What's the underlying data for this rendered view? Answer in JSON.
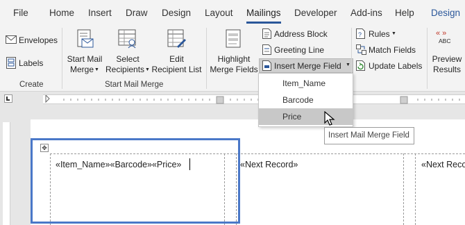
{
  "tabs": [
    {
      "label": "File"
    },
    {
      "label": "Home"
    },
    {
      "label": "Insert"
    },
    {
      "label": "Draw"
    },
    {
      "label": "Design"
    },
    {
      "label": "Layout"
    },
    {
      "label": "Mailings"
    },
    {
      "label": "Developer"
    },
    {
      "label": "Add-ins"
    },
    {
      "label": "Help"
    },
    {
      "label": "Design"
    }
  ],
  "active_tab": "Mailings",
  "accent_color": "#2b579a",
  "ribbon": {
    "create": {
      "envelopes": "Envelopes",
      "labels": "Labels",
      "group_label": "Create"
    },
    "start_mail_merge": {
      "start_mail_merge_line1": "Start Mail",
      "start_mail_merge_line2": "Merge",
      "select_recipients_line1": "Select",
      "select_recipients_line2": "Recipients",
      "edit_recipient_list_line1": "Edit",
      "edit_recipient_list_line2": "Recipient List",
      "group_label": "Start Mail Merge"
    },
    "write_insert": {
      "highlight_line1": "Highlight",
      "highlight_line2": "Merge Fields",
      "address_block": "Address Block",
      "greeting_line": "Greeting Line",
      "insert_merge_field": "Insert Merge Field"
    },
    "rules_group": {
      "rules": "Rules",
      "match_fields": "Match Fields",
      "update_labels": "Update Labels"
    },
    "preview": {
      "abc": "ABC",
      "preview_line1": "Preview",
      "preview_line2": "Results"
    }
  },
  "merge_field_menu": {
    "items": [
      {
        "label": "Item_Name"
      },
      {
        "label": "Barcode"
      },
      {
        "label": "Price"
      }
    ],
    "selected": "Price",
    "tooltip": "Insert Mail Merge Field"
  },
  "document": {
    "label_fields": "«Item_Name»«Barcode»«Price»",
    "next_record_1": "«Next Record»",
    "next_record_2": "«Next Reco"
  }
}
